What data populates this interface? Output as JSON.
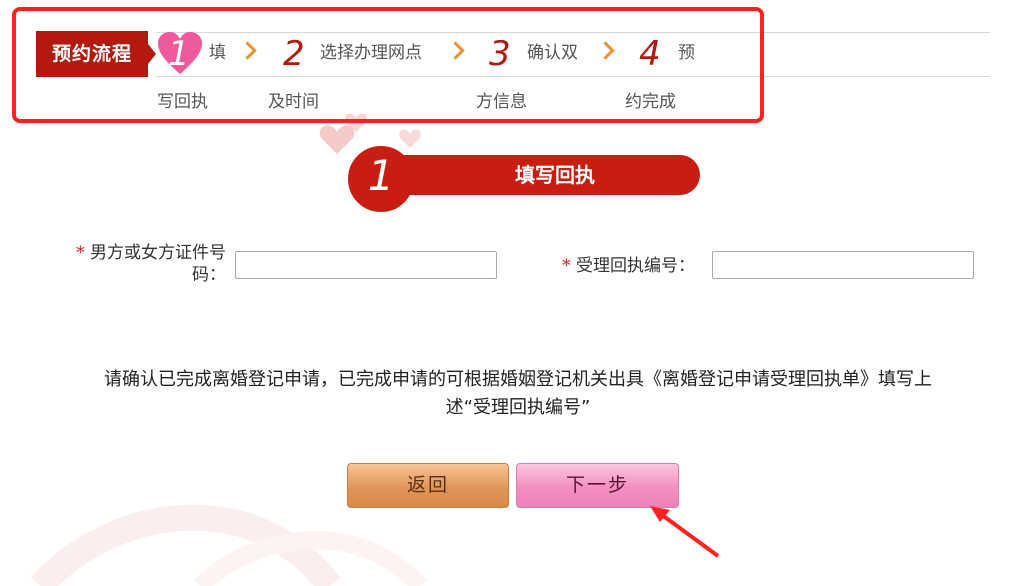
{
  "process": {
    "label": "预约流程",
    "steps": [
      {
        "num": "1",
        "line1": "填",
        "line2": "写回执"
      },
      {
        "num": "2",
        "line1": "选择办理网点",
        "line2": "及时间"
      },
      {
        "num": "3",
        "line1": "确认双",
        "line2": "方信息"
      },
      {
        "num": "4",
        "line1": "预",
        "line2": "约完成"
      }
    ]
  },
  "section": {
    "num": "1",
    "title": "填写回执"
  },
  "form": {
    "required_mark": "*",
    "id_label_line1": "男方或女方证件号",
    "id_label_line2": "码：",
    "id_value": "",
    "receipt_label": "受理回执编号：",
    "receipt_value": ""
  },
  "notice": {
    "line1": "请确认已完成离婚登记申请，已完成申请的可根据婚姻登记机关出具《离婚登记申请受理回执单》填写上",
    "line2": "述“受理回执编号”"
  },
  "buttons": {
    "back": "返回",
    "next": "下一步"
  },
  "colors": {
    "brand_red": "#b3190f",
    "accent_orange": "#e8923a",
    "annotation_red": "#ff2020"
  }
}
